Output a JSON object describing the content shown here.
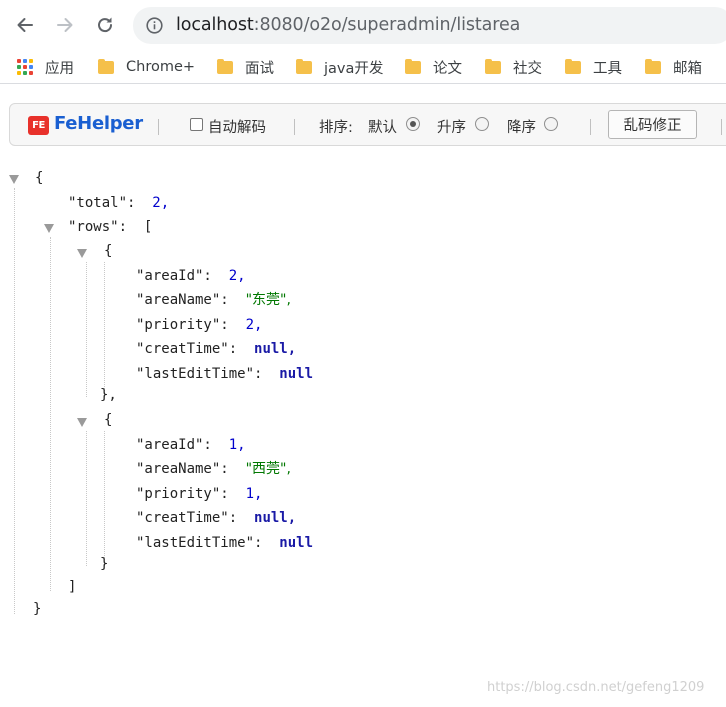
{
  "browser": {
    "url_host": "localhost",
    "url_path": ":8080/o2o/superadmin/listarea"
  },
  "bookmarks": {
    "apps_label": "应用",
    "items": [
      "Chrome+",
      "面试",
      "java开发",
      "论文",
      "社交",
      "工具",
      "邮箱"
    ]
  },
  "fehelper": {
    "logo_text": "FE",
    "title": "FeHelper",
    "auto_decode_label": "自动解码",
    "sort_label": "排序:",
    "sort_default": "默认",
    "sort_asc": "升序",
    "sort_desc": "降序",
    "fix_button": "乱码修正",
    "auto_decode_checked": false,
    "sort_selected": "默认"
  },
  "json_view": {
    "total_key": "\"total\":",
    "total_value": "2,",
    "rows_key": "\"rows\":",
    "rows": [
      {
        "areaId_key": "\"areaId\":",
        "areaId": "2,",
        "areaName_key": "\"areaName\":",
        "areaName": "\"东莞\",",
        "priority_key": "\"priority\":",
        "priority": "2,",
        "creatTime_key": "\"creatTime\":",
        "creatTime": "null,",
        "lastEditTime_key": "\"lastEditTime\":",
        "lastEditTime": "null"
      },
      {
        "areaId_key": "\"areaId\":",
        "areaId": "1,",
        "areaName_key": "\"areaName\":",
        "areaName": "\"西莞\",",
        "priority_key": "\"priority\":",
        "priority": "1,",
        "creatTime_key": "\"creatTime\":",
        "creatTime": "null,",
        "lastEditTime_key": "\"lastEditTime\":",
        "lastEditTime": "null"
      }
    ],
    "open_brace": "{",
    "close_brace": "}",
    "open_bracket": "[",
    "close_bracket": "]",
    "close_brace_comma": "},"
  },
  "watermark": "https://blog.csdn.net/gefeng1209",
  "colors": {
    "fe_title": "#1a5fd1",
    "number": "#0000cc",
    "string": "#007700",
    "null": "#1a1aa6"
  }
}
